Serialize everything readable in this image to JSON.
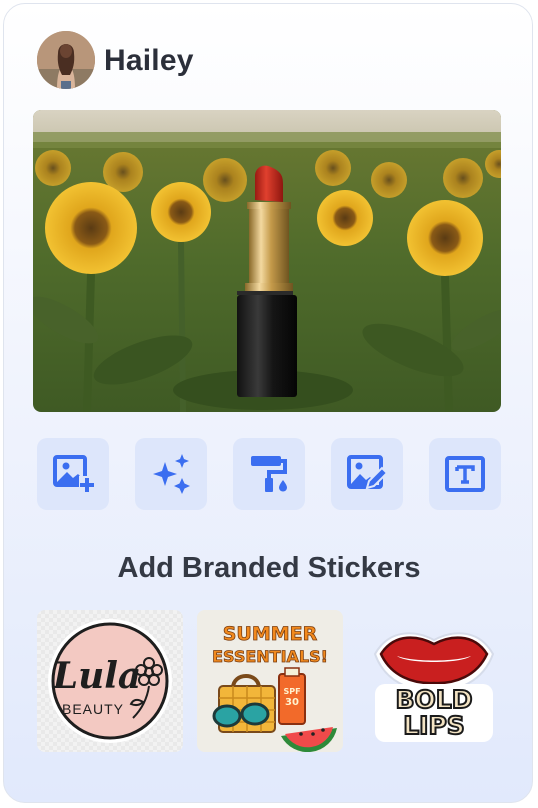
{
  "user": {
    "name": "Hailey",
    "avatar_icon": "profile-photo"
  },
  "photo": {
    "subject": "lipstick",
    "background": "sunflower-field"
  },
  "tools": [
    {
      "name": "add-image",
      "icon": "image-plus-icon"
    },
    {
      "name": "ai-magic",
      "icon": "sparkles-icon"
    },
    {
      "name": "paint-roller",
      "icon": "paint-roller-icon"
    },
    {
      "name": "edit-image",
      "icon": "image-edit-icon"
    },
    {
      "name": "add-text",
      "icon": "text-box-icon"
    }
  ],
  "section_title": "Add Branded Stickers",
  "stickers": [
    {
      "name": "lula-beauty",
      "brand": "Lula",
      "tagline": "BEAUTY"
    },
    {
      "name": "summer-essentials",
      "line1": "SUMMER",
      "line2": "ESSENTIALS!",
      "badge_line1": "SPF",
      "badge_line2": "30"
    },
    {
      "name": "bold-lips",
      "line1": "BOLD",
      "line2": "LIPS"
    }
  ],
  "colors": {
    "accent": "#3b6ef0",
    "tool_bg": "#dde6fb",
    "title_text": "#343944",
    "lipstick_red": "#c9281c"
  }
}
